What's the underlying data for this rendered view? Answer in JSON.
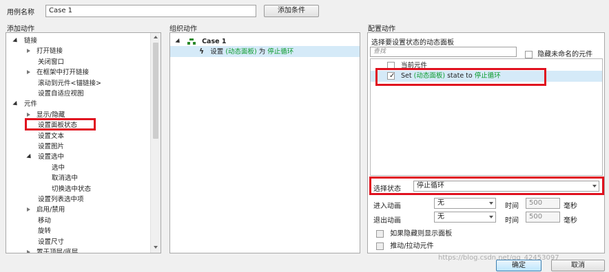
{
  "header": {
    "case_name_label": "用例名称",
    "case_name_value": "Case 1",
    "add_condition_label": "添加条件"
  },
  "left": {
    "title": "添加动作",
    "items": [
      {
        "label": "链接",
        "expand": "down"
      },
      {
        "label": "打开链接",
        "expand": "right"
      },
      {
        "label": "关闭窗口",
        "expand": ""
      },
      {
        "label": "在框架中打开链接",
        "expand": "right"
      },
      {
        "label": "滚动到元件<锚链接>",
        "expand": ""
      },
      {
        "label": "设置自适应视图",
        "expand": ""
      },
      {
        "label": "元件",
        "expand": "down"
      },
      {
        "label": "显示/隐藏",
        "expand": "right"
      },
      {
        "label": "设置面板状态",
        "expand": ""
      },
      {
        "label": "设置文本",
        "expand": ""
      },
      {
        "label": "设置图片",
        "expand": ""
      },
      {
        "label": "设置选中",
        "expand": "down"
      },
      {
        "label": "选中",
        "expand": ""
      },
      {
        "label": "取消选中",
        "expand": ""
      },
      {
        "label": "切换选中状态",
        "expand": ""
      },
      {
        "label": "设置列表选中项",
        "expand": ""
      },
      {
        "label": "启用/禁用",
        "expand": "right"
      },
      {
        "label": "移动",
        "expand": ""
      },
      {
        "label": "旋转",
        "expand": ""
      },
      {
        "label": "设置尺寸",
        "expand": ""
      },
      {
        "label": "置于顶层/底层",
        "expand": "right"
      }
    ]
  },
  "middle": {
    "title": "组织动作",
    "case_label": "Case 1",
    "action_prefix": "设置 ",
    "action_target": "(动态面板)",
    "action_mid": " 为 ",
    "action_state": "停止循环"
  },
  "right": {
    "title": "配置动作",
    "subtitle": "选择要设置状态的动态面板",
    "search_placeholder": "查找",
    "hide_unnamed_label": "隐藏未命名的元件",
    "list": {
      "current_widget": "当前元件",
      "set_prefix": "Set ",
      "set_target": "(动态面板)",
      "set_mid": " state to ",
      "set_state": "停止循环"
    },
    "state_label": "选择状态",
    "state_value": "停止循环",
    "enter_anim_label": "进入动画",
    "enter_anim_value": "无",
    "exit_anim_label": "退出动画",
    "exit_anim_value": "无",
    "time_label": "时间",
    "time_value_1": "500",
    "time_value_2": "500",
    "ms_label": "毫秒",
    "show_if_hidden_label": "如果隐藏则显示面板",
    "push_pull_label": "推动/拉动元件"
  },
  "footer": {
    "ok_label": "确定",
    "cancel_label": "取消",
    "watermark": "https://blog.csdn.net/qq_42453097"
  },
  "colors": {
    "highlight_red": "#e0101e",
    "state_green": "#0a9a2a",
    "selected_row": "#d5eaf8"
  }
}
